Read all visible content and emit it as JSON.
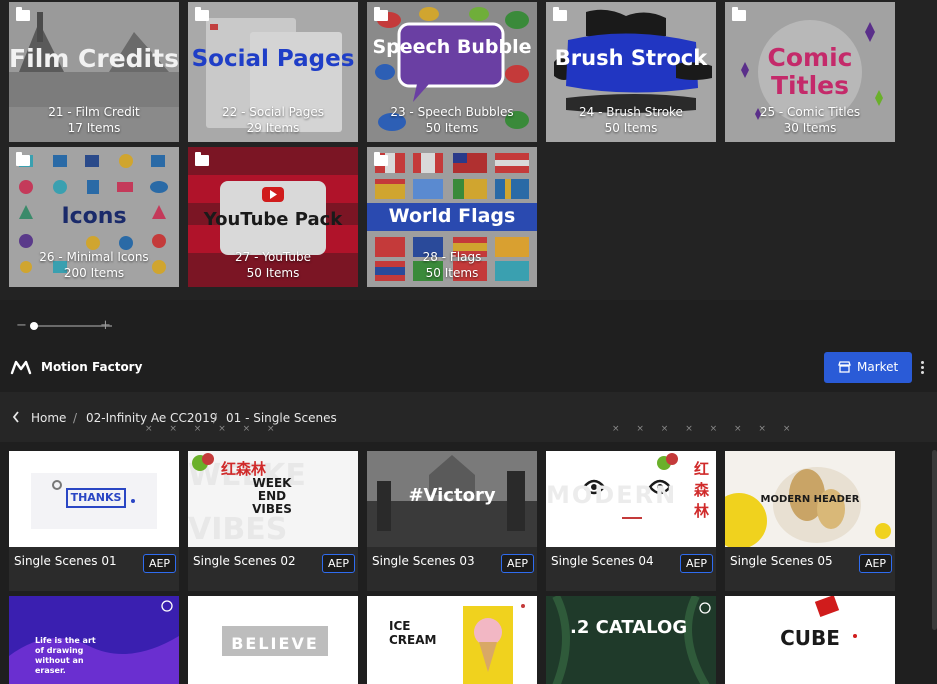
{
  "folders": [
    {
      "name": "21 - Film Credit",
      "count": "17 Items",
      "art": "Film Credits"
    },
    {
      "name": "22 - Social Pages",
      "count": "29 Items",
      "art": "Social Pages"
    },
    {
      "name": "23 - Speech Bubbles",
      "count": "50 Items",
      "art": "Speech Bubble"
    },
    {
      "name": "24 - Brush Stroke",
      "count": "50 Items",
      "art": "Brush Strock"
    },
    {
      "name": "25 - Comic Titles",
      "count": "30 Items",
      "art": "Comic Titles"
    },
    {
      "name": "26 - Minimal Icons",
      "count": "200 Items",
      "art": "Icons"
    },
    {
      "name": "27 - YouTube",
      "count": "50 Items",
      "art": "YouTube Pack"
    },
    {
      "name": "28 - Flags",
      "count": "50 Items",
      "art": "World Flags"
    }
  ],
  "zoom": {
    "minus": "−",
    "plus": "+",
    "level": 0.2
  },
  "header": {
    "title": "Motion Factory",
    "market_label": "Market"
  },
  "breadcrumb": [
    "Home",
    "02-Infinity Ae CC2019",
    "01 - Single Scenes"
  ],
  "scenes": [
    {
      "name": "Single Scenes 01",
      "badge": "AEP",
      "thumb_text": "THANKS"
    },
    {
      "name": "Single Scenes 02",
      "badge": "AEP",
      "thumb_text": "WEEK END VIBES"
    },
    {
      "name": "Single Scenes 03",
      "badge": "AEP",
      "thumb_text": "#Victory"
    },
    {
      "name": "Single Scenes 04",
      "badge": "AEP",
      "thumb_text": "MODERN"
    },
    {
      "name": "Single Scenes 05",
      "badge": "AEP",
      "thumb_text": "MODERN HEADER"
    }
  ],
  "scenes_row2": [
    {
      "thumb_text": "Life is the art of drawing without an eraser."
    },
    {
      "thumb_text": "BELIEVE"
    },
    {
      "thumb_text": "ICE CREAM"
    },
    {
      "thumb_text": ".2 CATALOG"
    },
    {
      "thumb_text": "CUBE"
    }
  ],
  "watermark": "红森林",
  "colors": {
    "accent": "#2a5bd7",
    "badge_border": "#2f6cf0",
    "background": "#1f1f1f"
  }
}
